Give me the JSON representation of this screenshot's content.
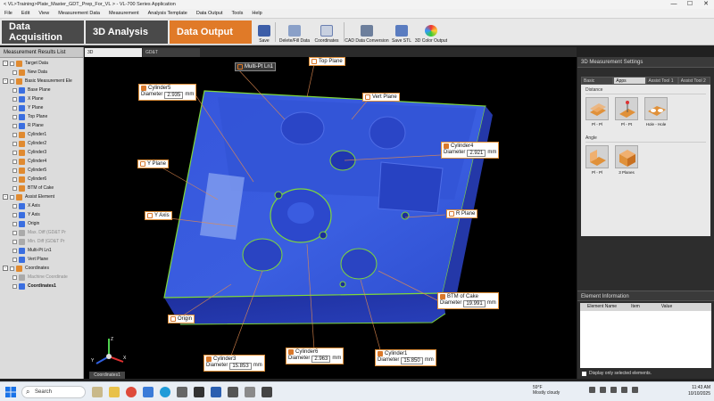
{
  "window": {
    "title": "< VL>Training>Plate_Master_GDT_Prep_For_VL > - VL-700 Series Application",
    "controls": [
      "—",
      "☐",
      "✕"
    ]
  },
  "menu": [
    "File",
    "Edit",
    "View",
    "Measurement Data",
    "Measurement",
    "Analysis Template",
    "Data Output",
    "Tools",
    "Help"
  ],
  "modes": {
    "acquisition": "Data Acquisition",
    "analysis": "3D Analysis",
    "output": "Data Output"
  },
  "tools": {
    "save": "Save",
    "delete_fill": "Delete/Fill Data",
    "coordinates": "Coordinates",
    "cad_conversion": "CAD Data Conversion",
    "save_stl": "Save STL",
    "color_output": "3D Color Output"
  },
  "left_panel": {
    "title": "Measurement Results List",
    "items": [
      {
        "label": "Target Data",
        "level": 0,
        "expander": "-"
      },
      {
        "label": "New Data",
        "level": 1
      },
      {
        "label": "Basic Measurement Ele",
        "level": 0,
        "expander": "-"
      },
      {
        "label": "Base Plane",
        "level": 1
      },
      {
        "label": "X Plane",
        "level": 1
      },
      {
        "label": "Y Plane",
        "level": 1
      },
      {
        "label": "Top Plane",
        "level": 1
      },
      {
        "label": "R Plane",
        "level": 1
      },
      {
        "label": "Cylinder1",
        "level": 1
      },
      {
        "label": "Cylinder2",
        "level": 1
      },
      {
        "label": "Cylinder3",
        "level": 1
      },
      {
        "label": "Cylinder4",
        "level": 1
      },
      {
        "label": "Cylinder5",
        "level": 1
      },
      {
        "label": "Cylinder6",
        "level": 1
      },
      {
        "label": "BTM of Cake",
        "level": 1
      },
      {
        "label": "Assist Element",
        "level": 0,
        "expander": "-"
      },
      {
        "label": "X Axis",
        "level": 1
      },
      {
        "label": "Y Axis",
        "level": 1
      },
      {
        "label": "Origin",
        "level": 1
      },
      {
        "label": "Max. Diff (GD&T Pr",
        "level": 1,
        "dim": true
      },
      {
        "label": "Min. Diff (GD&T Pr",
        "level": 1,
        "dim": true
      },
      {
        "label": "Multi-Pt Ln1",
        "level": 1
      },
      {
        "label": "Vert Plane",
        "level": 1
      },
      {
        "label": "Coordinates",
        "level": 0,
        "expander": "-"
      },
      {
        "label": "Machine Coordinate",
        "level": 1,
        "dim": true
      },
      {
        "label": "Coordinates1",
        "level": 1,
        "bold": true
      }
    ]
  },
  "view_tabs": [
    "3D",
    "GD&T"
  ],
  "viewport": {
    "labels": {
      "cylinder5": {
        "name": "Cylinder5",
        "field": "Diameter",
        "value": "2.935",
        "unit": "mm"
      },
      "cylinder4": {
        "name": "Cylinder4",
        "field": "Diameter",
        "value": "2.921",
        "unit": "mm"
      },
      "cylinder3": {
        "name": "Cylinder3",
        "field": "Diameter",
        "value": "15.853",
        "unit": "mm"
      },
      "cylinder6": {
        "name": "Cylinder6",
        "field": "Diameter",
        "value": "2.963",
        "unit": "mm"
      },
      "cylinder1": {
        "name": "Cylinder1",
        "field": "Diameter",
        "value": "15.850",
        "unit": "mm"
      },
      "btm_cake": {
        "name": "BTM of Cake",
        "field": "Diameter",
        "value": "19.991",
        "unit": "mm"
      },
      "multi_pt": "Multi-Pt Ln1",
      "top_plane": "Top Plane",
      "vert_plane": "Vert Plane",
      "y_plane": "Y Plane",
      "y_axis": "Y Axis",
      "r_plane": "R Plane",
      "origin": "Origin"
    },
    "triad": {
      "x": "X",
      "y": "Y",
      "z": "Z",
      "label": "Coordinates1"
    }
  },
  "right_panel": {
    "title": "3D Measurement Settings",
    "tabs": [
      "Basic",
      "Apps",
      "Assist Tool 1",
      "Assist Tool 2"
    ],
    "distance": {
      "title": "Distance",
      "buttons": [
        "Pl - Pl",
        "Pl - Pt",
        "Hole - Hole"
      ]
    },
    "angle": {
      "title": "Angle",
      "buttons": [
        "Pl - Pl",
        "3 Planes"
      ]
    },
    "element_info": {
      "title": "Element Information",
      "columns": [
        "Element Name",
        "Item",
        "Value"
      ],
      "footer": "Display only selected elements."
    }
  },
  "taskbar": {
    "search": "Search",
    "weather_temp": "59°F",
    "weather_desc": "Mostly cloudy",
    "time": "11:43 AM",
    "date": "10/10/2025"
  },
  "colors": {
    "mode_acquisition": "#4a4a4a",
    "mode_analysis": "#4a4a4a",
    "mode_output": "#e07a28",
    "part_blue": "#2f4fd8",
    "edge_green": "#7fd83a",
    "label_border": "#e0903a"
  }
}
